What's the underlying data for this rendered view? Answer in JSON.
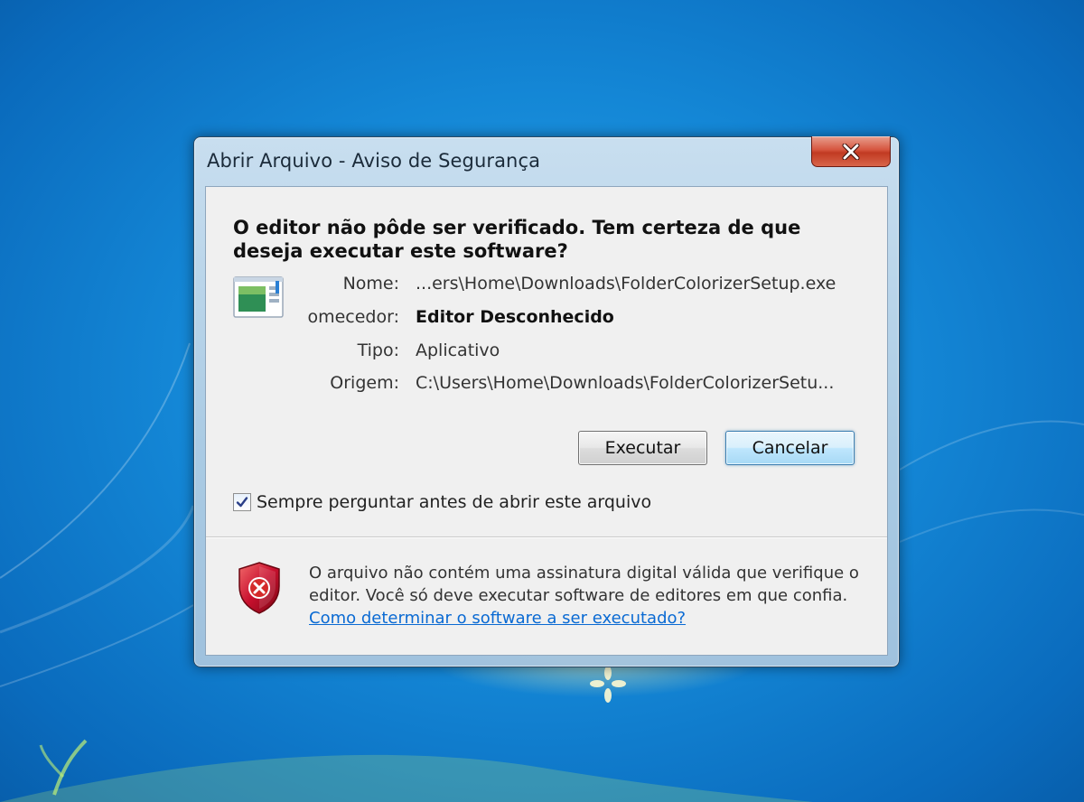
{
  "window": {
    "title": "Abrir Arquivo - Aviso de Segurança",
    "close_glyph": "✕"
  },
  "dialog": {
    "heading": "O editor não pôde ser verificado. Tem certeza de que deseja executar este software?",
    "fields": [
      {
        "label": "Nome:",
        "value": "...ers\\Home\\Downloads\\FolderColorizerSetup.exe"
      },
      {
        "label": "omecedor:",
        "value": "Editor Desconhecido"
      },
      {
        "label": "Tipo:",
        "value": "Aplicativo"
      },
      {
        "label": "Origem:",
        "value": "C:\\Users\\Home\\Downloads\\FolderColorizerSetu..."
      }
    ],
    "buttons": {
      "run": "Executar",
      "cancel": "Cancelar"
    },
    "checkbox": {
      "label": "Sempre perguntar antes de abrir este arquivo",
      "checked": true
    },
    "warning": {
      "text": "O arquivo não contém uma assinatura digital válida que verifique o editor. Você só deve executar software de editores em que confia.",
      "link": "Como determinar o software a ser executado?"
    }
  },
  "icons": {
    "app": "application-icon",
    "shield": "shield-error-icon",
    "close": "close-icon",
    "check": "checkmark-icon"
  },
  "colors": {
    "desktop": "#1487d6",
    "link": "#0a6ad3",
    "close_button": "#c13a22",
    "shield": "#c8102e"
  }
}
